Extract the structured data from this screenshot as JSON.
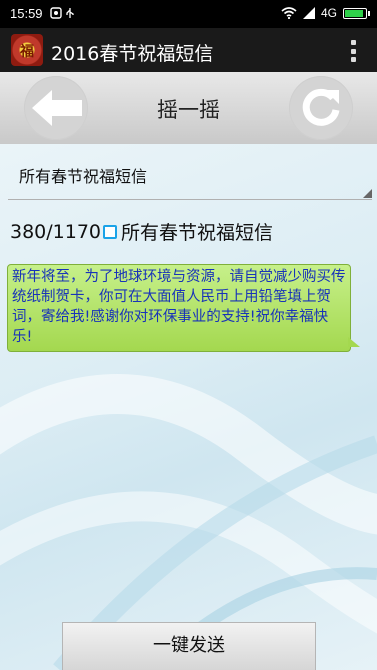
{
  "status_bar": {
    "time": "15:59",
    "network": "4G",
    "icons": [
      "notification-icon",
      "usb-icon",
      "wifi-icon",
      "signal-icon",
      "battery-icon"
    ],
    "battery_color": "#2fd14a"
  },
  "app_bar": {
    "icon_glyph": "福",
    "title": "2016春节祝福短信"
  },
  "header": {
    "title": "摇一摇"
  },
  "spinner": {
    "selected": "所有春节祝福短信"
  },
  "counter": {
    "text": "380/1170",
    "checkbox_label": "所有春节祝福短信"
  },
  "message": {
    "text": "新年将至，为了地球环境与资源，请自觉减少购买传统纸制贺卡，你可在大面值人民币上用铅笔填上贺词，寄给我!感谢你对环保事业的支持!祝你幸福快乐!"
  },
  "send_button": {
    "label": "一键发送"
  },
  "colors": {
    "app_bar_bg": "#1a1a1a",
    "bubble_bg": "#b4e26a",
    "bubble_text": "#1833b8",
    "checkbox": "#1aa3e8"
  }
}
